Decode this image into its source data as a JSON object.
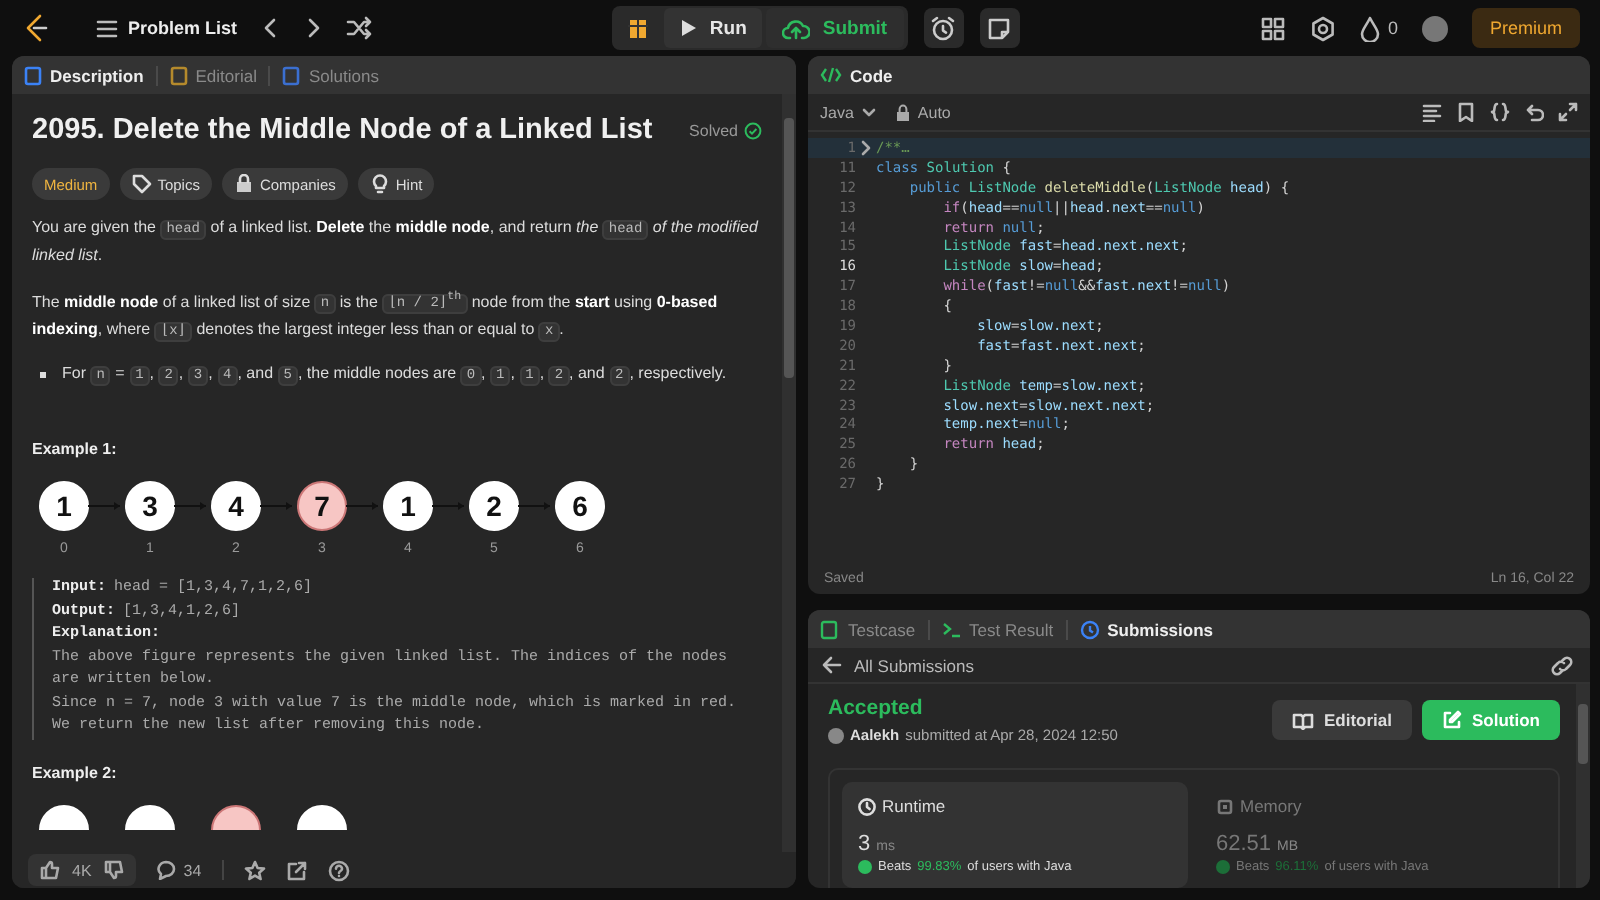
{
  "top_bar": {
    "problem_list": "Problem List",
    "run": "Run",
    "submit": "Submit",
    "streak": "0",
    "premium": "Premium"
  },
  "description_panel": {
    "tabs": [
      {
        "label": "Description",
        "selected": true
      },
      {
        "label": "Editorial",
        "selected": false
      },
      {
        "label": "Solutions",
        "selected": false
      }
    ],
    "title": "2095. Delete the Middle Node of a Linked List",
    "status": "Solved",
    "tags": [
      {
        "kind": "difficulty",
        "label": "Medium"
      },
      {
        "kind": "topics",
        "label": "Topics"
      },
      {
        "kind": "companies",
        "label": "Companies"
      },
      {
        "kind": "hint",
        "label": "Hint"
      }
    ],
    "paragraphs": [
      [
        {
          "kind": "text",
          "text": "You are given the "
        },
        {
          "kind": "code",
          "text": "head"
        },
        {
          "kind": "text",
          "text": " of a linked list. **Delete** the **middle node**, and return *the* "
        },
        {
          "kind": "code",
          "text": "head"
        },
        {
          "kind": "text",
          "text": " *of the modified linked list*."
        }
      ],
      [
        {
          "kind": "text",
          "text": "The **middle node** of a linked list of size "
        },
        {
          "kind": "code",
          "text": "n"
        },
        {
          "kind": "text",
          "text": " is the "
        },
        {
          "kind": "code",
          "text": "⌊n / 2⌋$^{th}$"
        },
        {
          "kind": "text",
          "text": " node from the **start** using **0-based indexing**, where "
        },
        {
          "kind": "code",
          "text": "⌊x⌋"
        },
        {
          "kind": "text",
          "text": " denotes the largest integer less than or equal to "
        },
        {
          "kind": "code",
          "text": "x"
        },
        {
          "kind": "text",
          "text": "."
        }
      ]
    ],
    "bullets": [
      [
        {
          "kind": "text",
          "text": "For "
        },
        {
          "kind": "code",
          "text": "n"
        },
        {
          "kind": "text",
          "text": " = "
        },
        {
          "kind": "code",
          "text": "1"
        },
        {
          "kind": "text",
          "text": ", "
        },
        {
          "kind": "code",
          "text": "2"
        },
        {
          "kind": "text",
          "text": ", "
        },
        {
          "kind": "code",
          "text": "3"
        },
        {
          "kind": "text",
          "text": ", "
        },
        {
          "kind": "code",
          "text": "4"
        },
        {
          "kind": "text",
          "text": ", and "
        },
        {
          "kind": "code",
          "text": "5"
        },
        {
          "kind": "text",
          "text": ", the middle nodes are "
        },
        {
          "kind": "code",
          "text": "0"
        },
        {
          "kind": "text",
          "text": ", "
        },
        {
          "kind": "code",
          "text": "1"
        },
        {
          "kind": "text",
          "text": ", "
        },
        {
          "kind": "code",
          "text": "1"
        },
        {
          "kind": "text",
          "text": ", "
        },
        {
          "kind": "code",
          "text": "2"
        },
        {
          "kind": "text",
          "text": ", and "
        },
        {
          "kind": "code",
          "text": "2"
        },
        {
          "kind": "text",
          "text": ", respectively."
        }
      ]
    ],
    "example_1": {
      "title": "Example 1:",
      "nodes": [
        {
          "value": "1",
          "index": "0",
          "highlighted": false
        },
        {
          "value": "3",
          "index": "1",
          "highlighted": false
        },
        {
          "value": "4",
          "index": "2",
          "highlighted": false
        },
        {
          "value": "7",
          "index": "3",
          "highlighted": true
        },
        {
          "value": "1",
          "index": "4",
          "highlighted": false
        },
        {
          "value": "2",
          "index": "5",
          "highlighted": false
        },
        {
          "value": "6",
          "index": "6",
          "highlighted": false
        }
      ],
      "input_label": "Input:",
      "input": "head = [1,3,4,7,1,2,6]",
      "output_label": "Output:",
      "output": "[1,3,4,1,2,6]",
      "explanation_label": "Explanation:",
      "explanation": [
        "The above figure represents the given linked list. The indices of the nodes are written below.",
        "Since n = 7, node 3 with value 7 is the middle node, which is marked in red.",
        "We return the new list after removing this node."
      ]
    },
    "example_2": {
      "title": "Example 2:",
      "nodes": [
        {
          "highlighted": false
        },
        {
          "highlighted": false
        },
        {
          "highlighted": true
        },
        {
          "highlighted": false
        }
      ]
    },
    "footer": {
      "likes": "4K",
      "comments": "34"
    }
  },
  "code_panel": {
    "tab": "Code",
    "language": "Java",
    "mode": "Auto",
    "status": "Saved",
    "cursor": "Ln 16, Col 22",
    "lines": [
      {
        "number": "1",
        "current": false,
        "folded": true,
        "tokens": [
          {
            "kind": "comment",
            "text": "/**…"
          }
        ]
      },
      {
        "number": "11",
        "current": false,
        "folded": false,
        "tokens": [
          {
            "kind": "kw",
            "text": "class "
          },
          {
            "kind": "type",
            "text": "Solution"
          },
          {
            "kind": "plain",
            "text": " {"
          }
        ]
      },
      {
        "number": "12",
        "current": false,
        "folded": false,
        "tokens": [
          {
            "kind": "kw",
            "text": "    public "
          },
          {
            "kind": "type",
            "text": "ListNode "
          },
          {
            "kind": "fn",
            "text": "deleteMiddle"
          },
          {
            "kind": "plain",
            "text": "("
          },
          {
            "kind": "type",
            "text": "ListNode "
          },
          {
            "kind": "var",
            "text": "head"
          },
          {
            "kind": "plain",
            "text": ") {"
          }
        ]
      },
      {
        "number": "13",
        "current": false,
        "folded": false,
        "tokens": [
          {
            "kind": "ctl",
            "text": "        if"
          },
          {
            "kind": "plain",
            "text": "("
          },
          {
            "kind": "var",
            "text": "head"
          },
          {
            "kind": "plain",
            "text": "=="
          },
          {
            "kind": "lit",
            "text": "null"
          },
          {
            "kind": "plain",
            "text": "||"
          },
          {
            "kind": "var",
            "text": "head"
          },
          {
            "kind": "plain",
            "text": "."
          },
          {
            "kind": "var",
            "text": "next"
          },
          {
            "kind": "plain",
            "text": "=="
          },
          {
            "kind": "lit",
            "text": "null"
          },
          {
            "kind": "plain",
            "text": ")"
          }
        ]
      },
      {
        "number": "14",
        "current": false,
        "folded": false,
        "tokens": [
          {
            "kind": "ctl",
            "text": "        return "
          },
          {
            "kind": "lit",
            "text": "null"
          },
          {
            "kind": "plain",
            "text": ";"
          }
        ]
      },
      {
        "number": "15",
        "current": false,
        "folded": false,
        "tokens": [
          {
            "kind": "type",
            "text": "        ListNode "
          },
          {
            "kind": "var",
            "text": "fast"
          },
          {
            "kind": "plain",
            "text": "="
          },
          {
            "kind": "var",
            "text": "head.next.next"
          },
          {
            "kind": "plain",
            "text": ";"
          }
        ]
      },
      {
        "number": "16",
        "current": true,
        "folded": false,
        "tokens": [
          {
            "kind": "type",
            "text": "        ListNode "
          },
          {
            "kind": "var",
            "text": "slow"
          },
          {
            "kind": "plain",
            "text": "="
          },
          {
            "kind": "var",
            "text": "head"
          },
          {
            "kind": "plain",
            "text": ";"
          }
        ]
      },
      {
        "number": "17",
        "current": false,
        "folded": false,
        "tokens": [
          {
            "kind": "ctl",
            "text": "        while"
          },
          {
            "kind": "plain",
            "text": "("
          },
          {
            "kind": "var",
            "text": "fast"
          },
          {
            "kind": "plain",
            "text": "!="
          },
          {
            "kind": "lit",
            "text": "null"
          },
          {
            "kind": "plain",
            "text": "&&"
          },
          {
            "kind": "var",
            "text": "fast.next"
          },
          {
            "kind": "plain",
            "text": "!="
          },
          {
            "kind": "lit",
            "text": "null"
          },
          {
            "kind": "plain",
            "text": ")"
          }
        ]
      },
      {
        "number": "18",
        "current": false,
        "folded": false,
        "tokens": [
          {
            "kind": "plain",
            "text": "        {"
          }
        ]
      },
      {
        "number": "19",
        "current": false,
        "folded": false,
        "tokens": [
          {
            "kind": "var",
            "text": "            slow"
          },
          {
            "kind": "plain",
            "text": "="
          },
          {
            "kind": "var",
            "text": "slow.next"
          },
          {
            "kind": "plain",
            "text": ";"
          }
        ]
      },
      {
        "number": "20",
        "current": false,
        "folded": false,
        "tokens": [
          {
            "kind": "var",
            "text": "            fast"
          },
          {
            "kind": "plain",
            "text": "="
          },
          {
            "kind": "var",
            "text": "fast.next.next"
          },
          {
            "kind": "plain",
            "text": ";"
          }
        ]
      },
      {
        "number": "21",
        "current": false,
        "folded": false,
        "tokens": [
          {
            "kind": "plain",
            "text": "        }"
          }
        ]
      },
      {
        "number": "22",
        "current": false,
        "folded": false,
        "tokens": [
          {
            "kind": "type",
            "text": "        ListNode "
          },
          {
            "kind": "var",
            "text": "temp"
          },
          {
            "kind": "plain",
            "text": "="
          },
          {
            "kind": "var",
            "text": "slow.next"
          },
          {
            "kind": "plain",
            "text": ";"
          }
        ]
      },
      {
        "number": "23",
        "current": false,
        "folded": false,
        "tokens": [
          {
            "kind": "var",
            "text": "        slow.next"
          },
          {
            "kind": "plain",
            "text": "="
          },
          {
            "kind": "var",
            "text": "slow.next.next"
          },
          {
            "kind": "plain",
            "text": ";"
          }
        ]
      },
      {
        "number": "24",
        "current": false,
        "folded": false,
        "tokens": [
          {
            "kind": "var",
            "text": "        temp.next"
          },
          {
            "kind": "plain",
            "text": "="
          },
          {
            "kind": "lit",
            "text": "null"
          },
          {
            "kind": "plain",
            "text": ";"
          }
        ]
      },
      {
        "number": "25",
        "current": false,
        "folded": false,
        "tokens": [
          {
            "kind": "ctl",
            "text": "        return "
          },
          {
            "kind": "var",
            "text": "head"
          },
          {
            "kind": "plain",
            "text": ";"
          }
        ]
      },
      {
        "number": "26",
        "current": false,
        "folded": false,
        "tokens": [
          {
            "kind": "plain",
            "text": "    }"
          }
        ]
      },
      {
        "number": "27",
        "current": false,
        "folded": false,
        "tokens": [
          {
            "kind": "plain",
            "text": "}"
          }
        ]
      }
    ]
  },
  "result_panel": {
    "tabs": [
      {
        "label": "Testcase",
        "selected": false
      },
      {
        "label": "Test Result",
        "selected": false
      },
      {
        "label": "Submissions",
        "selected": true
      }
    ],
    "back": "All Submissions",
    "verdict": "Accepted",
    "user": "Aalekh",
    "submitted": "submitted at Apr 28, 2024 12:50",
    "buttons": [
      {
        "kind": "editorial",
        "label": "Editorial"
      },
      {
        "kind": "solution",
        "label": "Solution"
      }
    ],
    "metrics": [
      {
        "kind": "runtime",
        "label": "Runtime",
        "selected": true,
        "value": "3",
        "unit": "ms",
        "beats": "Beats",
        "percent": "99.83%",
        "rest": "of users with Java"
      },
      {
        "kind": "memory",
        "label": "Memory",
        "selected": false,
        "value": "62.51",
        "unit": "MB",
        "beats": "Beats",
        "percent": "96.11%",
        "rest": "of users with Java"
      }
    ]
  }
}
